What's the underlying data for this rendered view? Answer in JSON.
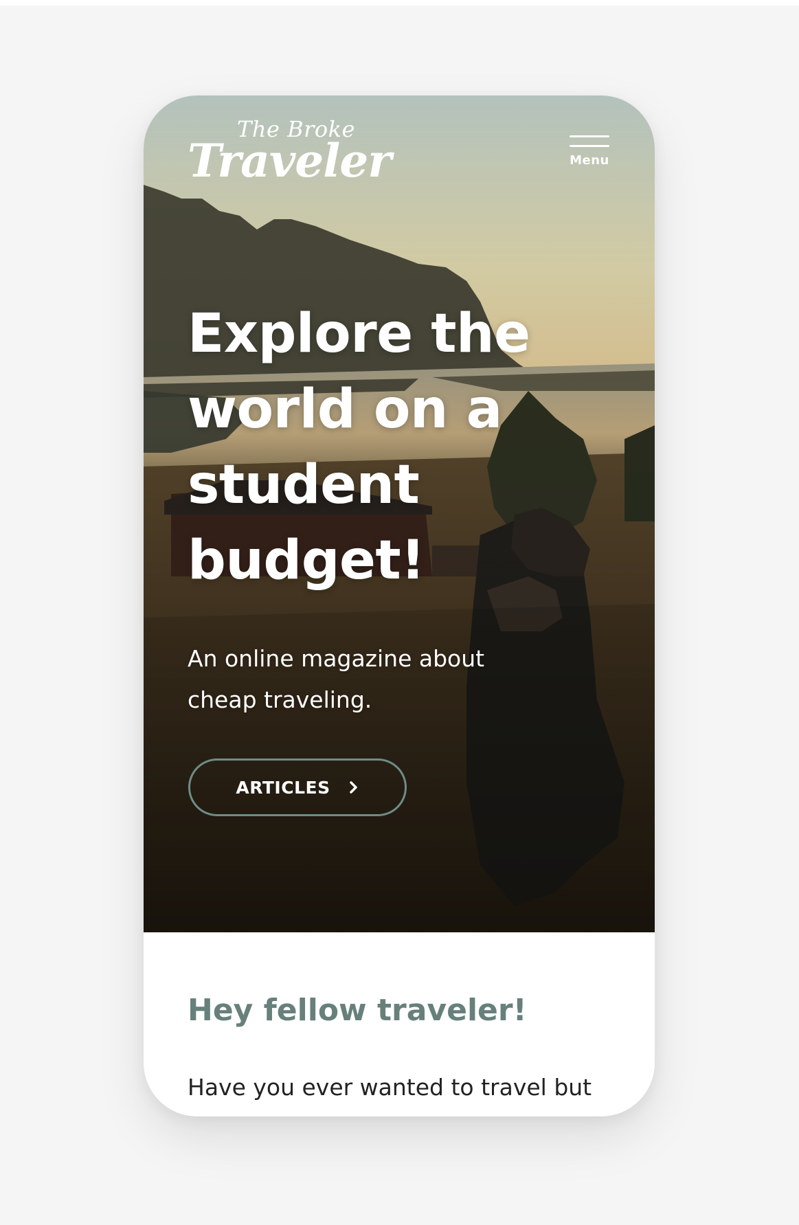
{
  "brand": {
    "logo_small": "The Broke",
    "logo_big": "Traveler"
  },
  "header": {
    "menu_label": "Menu",
    "menu_icon": "hamburger-icon"
  },
  "hero": {
    "headline": "Explore the world on a student budget!",
    "subtitle": "An online magazine about cheap traveling.",
    "cta_label": "ARTICLES",
    "cta_icon": "chevron-right-icon"
  },
  "intro": {
    "heading": "Hey fellow traveler!",
    "text": "Have you ever wanted to travel but"
  },
  "colors": {
    "accent": "#67807b",
    "button_border": "#6f8c88",
    "page_background": "#f5f5f5",
    "body_text": "#222222"
  }
}
